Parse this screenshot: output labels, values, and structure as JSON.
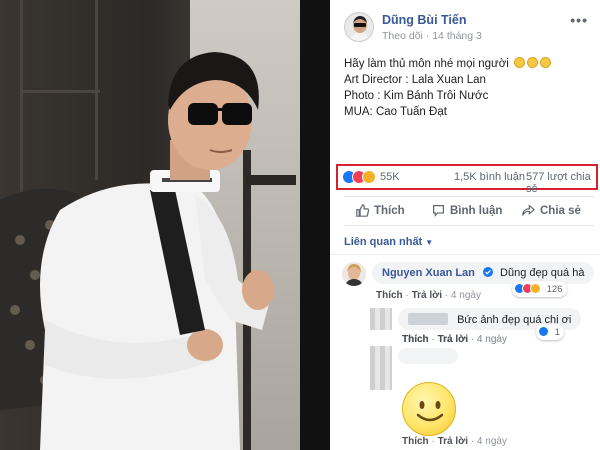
{
  "post": {
    "author": "Dũng Bùi Tiến",
    "follow_label": "Theo dõi",
    "date": "14 tháng 3",
    "more_label": "•••",
    "lines": [
      "Hãy làm thủ môn nhé mọi người",
      "Art Director : Lala Xuan Lan",
      "Photo : Kim Bánh Trôi Nước",
      "MUA: Cao Tuấn Đạt"
    ]
  },
  "stats": {
    "reactions": "55K",
    "comments": "1,5K bình luận",
    "shares": "577 lượt chia sẻ",
    "highlight_color": "#d6202e"
  },
  "actions": {
    "like": "Thích",
    "comment": "Bình luận",
    "share": "Chia sẻ"
  },
  "sort_label": "Liên quan nhất",
  "comments": [
    {
      "name": "Nguyen Xuan Lan",
      "text": "Dũng đẹp quá hà",
      "like": "Thích",
      "reply": "Trả lời",
      "time": "4 ngày",
      "reactions": "126"
    },
    {
      "text": "Bức ảnh đẹp quá chị ơi",
      "like": "Thích",
      "reply": "Trả lời",
      "time": "4 ngày",
      "reactions": "1"
    },
    {
      "like": "Thích",
      "reply": "Trả lời",
      "time": "4 ngày"
    },
    {
      "like": "Thích",
      "reply": "Trả lời",
      "time": "4 ngày"
    }
  ],
  "colors": {
    "link_blue": "#385898",
    "facebook_blue": "#1877f2",
    "secondary_text": "#606770"
  },
  "icons": [
    "like-icon",
    "comment-icon",
    "share-icon",
    "verified-icon",
    "love-icon",
    "haha-icon",
    "smile-sticker"
  ]
}
